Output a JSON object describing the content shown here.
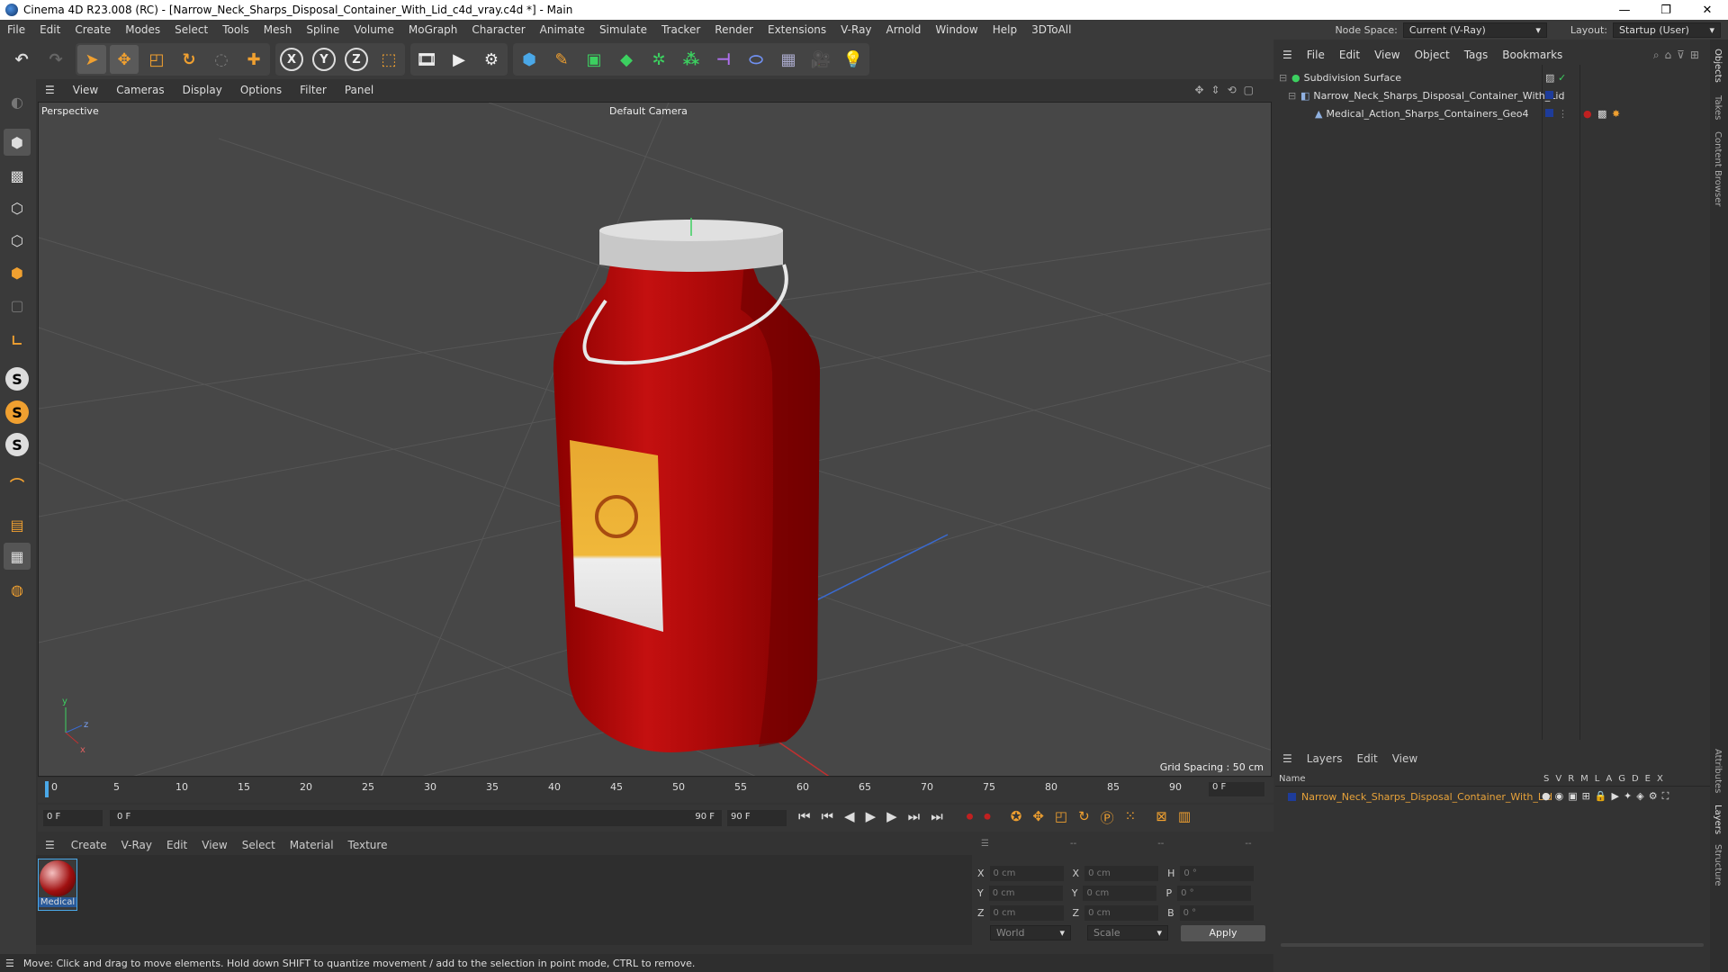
{
  "window": {
    "title": "Cinema 4D R23.008 (RC) - [Narrow_Neck_Sharps_Disposal_Container_With_Lid_c4d_vray.c4d *] - Main",
    "minimize": "—",
    "maximize": "❐",
    "close": "✕"
  },
  "menu": {
    "items": [
      "File",
      "Edit",
      "Create",
      "Modes",
      "Select",
      "Tools",
      "Mesh",
      "Spline",
      "Volume",
      "MoGraph",
      "Character",
      "Animate",
      "Simulate",
      "Tracker",
      "Render",
      "Extensions",
      "V-Ray",
      "Arnold",
      "Window",
      "Help",
      "3DToAll"
    ],
    "node_space_label": "Node Space:",
    "node_space_value": "Current (V-Ray)",
    "layout_label": "Layout:",
    "layout_value": "Startup (User)"
  },
  "viewport": {
    "menu": [
      "View",
      "Cameras",
      "Display",
      "Options",
      "Filter",
      "Panel"
    ],
    "label": "Perspective",
    "camera": "Default Camera",
    "grid_spacing": "Grid Spacing : 50 cm",
    "axis_y": "y",
    "axis_z": "z",
    "axis_x": "x"
  },
  "timeline": {
    "ticks": [
      "0",
      "5",
      "10",
      "15",
      "20",
      "25",
      "30",
      "35",
      "40",
      "45",
      "50",
      "55",
      "60",
      "65",
      "70",
      "75",
      "80",
      "85",
      "90"
    ],
    "frame_field": "0 F"
  },
  "transport": {
    "start": "0 F",
    "range_start": "0 F",
    "range_end": "90 F",
    "end": "90 F"
  },
  "material": {
    "menu": [
      "Create",
      "V-Ray",
      "Edit",
      "View",
      "Select",
      "Material",
      "Texture"
    ],
    "name": "Medical"
  },
  "coords": {
    "header": [
      "--",
      "--",
      "--"
    ],
    "rows": [
      {
        "a": "X",
        "av": "0 cm",
        "b": "X",
        "bv": "0 cm",
        "c": "H",
        "cv": "0 °"
      },
      {
        "a": "Y",
        "av": "0 cm",
        "b": "Y",
        "bv": "0 cm",
        "c": "P",
        "cv": "0 °"
      },
      {
        "a": "Z",
        "av": "0 cm",
        "b": "Z",
        "bv": "0 cm",
        "c": "B",
        "cv": "0 °"
      }
    ],
    "world": "World",
    "scale": "Scale",
    "apply": "Apply"
  },
  "status": "Move: Click and drag to move elements. Hold down SHIFT to quantize movement / add to the selection in point mode, CTRL to remove.",
  "objects": {
    "menu": [
      "File",
      "Edit",
      "View",
      "Object",
      "Tags",
      "Bookmarks"
    ],
    "tree": [
      "Subdivision Surface",
      "Narrow_Neck_Sharps_Disposal_Container_With_Lid",
      "Medical_Action_Sharps_Containers_Geo4"
    ]
  },
  "layers": {
    "menu": [
      "Layers",
      "Edit",
      "View"
    ],
    "name_col": "Name",
    "flags": [
      "S",
      "V",
      "R",
      "M",
      "L",
      "A",
      "G",
      "D",
      "E",
      "X"
    ],
    "row": "Narrow_Neck_Sharps_Disposal_Container_With_Lid"
  },
  "side_tabs": [
    "Objects",
    "Takes",
    "Content Browser",
    "Attributes",
    "Layers",
    "Structure"
  ],
  "colors": {
    "accent": "#e8a33a",
    "layer_blue": "#1e3c9a",
    "bottle": "#b00a0a"
  }
}
